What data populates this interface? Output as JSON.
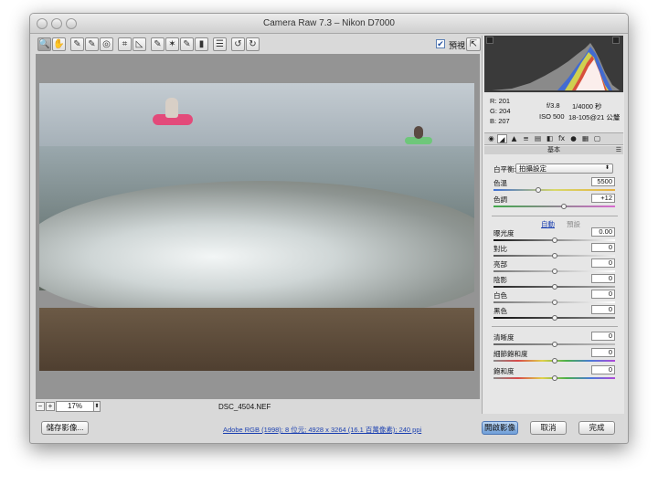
{
  "window": {
    "title": "Camera Raw 7.3  –  Nikon D7000"
  },
  "toolbar": {
    "tools": [
      {
        "name": "zoom-tool-icon",
        "glyph": "🔍"
      },
      {
        "name": "hand-tool-icon",
        "glyph": "✋"
      },
      {
        "name": "white-balance-tool-icon",
        "glyph": "✎"
      },
      {
        "name": "color-sampler-tool-icon",
        "glyph": "✎"
      },
      {
        "name": "targeted-adjustment-tool-icon",
        "glyph": "◎"
      },
      {
        "name": "crop-tool-icon",
        "glyph": "⌗"
      },
      {
        "name": "straighten-tool-icon",
        "glyph": "◺"
      },
      {
        "name": "spot-removal-tool-icon",
        "glyph": "✎"
      },
      {
        "name": "red-eye-removal-tool-icon",
        "glyph": "✶"
      },
      {
        "name": "adjustment-brush-icon",
        "glyph": "✎"
      },
      {
        "name": "graduated-filter-icon",
        "glyph": "▮"
      },
      {
        "name": "preferences-icon",
        "glyph": "☰"
      },
      {
        "name": "rotate-left-icon",
        "glyph": "↺"
      },
      {
        "name": "rotate-right-icon",
        "glyph": "↻"
      }
    ],
    "preview_label": "預視",
    "preview_checked": "✔",
    "fullscreen_glyph": "⇱"
  },
  "statusbar": {
    "zoom_minus": "−",
    "zoom_plus": "+",
    "zoom_value": "17%",
    "zoom_arrow": "⬍",
    "filename": "DSC_4504.NEF"
  },
  "footer": {
    "save_label": "儲存影像...",
    "workflow_options": "Adobe RGB (1998); 8 位元; 4928 x 3264 (16.1 百萬像素); 240 ppi",
    "open_label": "開啟影像",
    "cancel_label": "取消",
    "done_label": "完成"
  },
  "readout": {
    "r_label": "R:",
    "r_value": "201",
    "g_label": "G:",
    "g_value": "204",
    "b_label": "B:",
    "b_value": "207",
    "aperture": "f/3.8",
    "shutter": "1/4000 秒",
    "iso": "ISO 500",
    "lens": "18-105@21 公釐"
  },
  "panel": {
    "tabs": [
      "◉",
      "◢",
      "▲",
      "≡",
      "▤",
      "◧",
      "fx",
      "●",
      "▦",
      "▢"
    ],
    "header": "基本",
    "menu_glyph": "☰",
    "white_balance_label": "白平衡:",
    "white_balance_value": "拍攝設定",
    "select_arrow": "⬍",
    "auto_label": "自動",
    "default_label": "預設",
    "sliders": [
      {
        "key": "temperature",
        "label": "色溫",
        "value": "5500",
        "position": 0.37
      },
      {
        "key": "tint",
        "label": "色調",
        "value": "+12",
        "position": 0.58
      },
      {
        "key": "exposure",
        "label": "曝光度",
        "value": "0.00",
        "position": 0.5
      },
      {
        "key": "contrast",
        "label": "對比",
        "value": "0",
        "position": 0.5
      },
      {
        "key": "highlights",
        "label": "亮部",
        "value": "0",
        "position": 0.5
      },
      {
        "key": "shadows",
        "label": "陰影",
        "value": "0",
        "position": 0.5
      },
      {
        "key": "whites",
        "label": "白色",
        "value": "0",
        "position": 0.5
      },
      {
        "key": "blacks",
        "label": "黑色",
        "value": "0",
        "position": 0.5
      },
      {
        "key": "clarity",
        "label": "清晰度",
        "value": "0",
        "position": 0.5
      },
      {
        "key": "vibrance",
        "label": "細節飽和度",
        "value": "0",
        "position": 0.5
      },
      {
        "key": "saturation",
        "label": "飽和度",
        "value": "0",
        "position": 0.5
      }
    ]
  },
  "colors": {
    "canvas_bg": "#949494",
    "histogram_bg": "#3a3a3a",
    "link": "#1a3fb0",
    "primary_button": "#6e9ed8"
  }
}
